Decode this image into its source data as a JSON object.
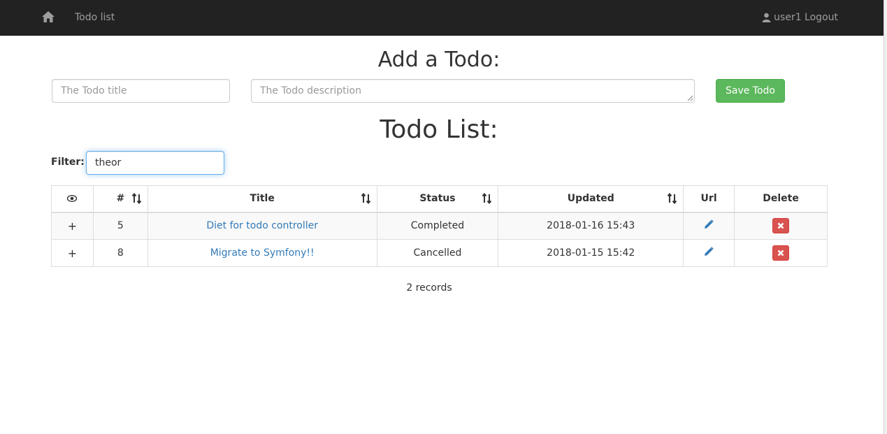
{
  "navbar": {
    "home_icon": "home-icon",
    "brand": "Todo list",
    "user_icon": "user-icon",
    "user_label": "user1 Logout"
  },
  "add_form": {
    "heading": "Add a Todo:",
    "title_placeholder": "The Todo title",
    "description_placeholder": "The Todo description",
    "save_label": "Save Todo"
  },
  "list": {
    "heading": "Todo List:",
    "filter_label": "Filter:",
    "filter_value": "theor",
    "columns": {
      "visibility_icon": "eye-icon",
      "id": "#",
      "title": "Title",
      "status": "Status",
      "updated": "Updated",
      "url": "Url",
      "delete": "Delete"
    },
    "rows": [
      {
        "expand": "+",
        "id": "5",
        "title": "Diet for todo controller",
        "status": "Completed",
        "updated": "2018-01-16 15:43"
      },
      {
        "expand": "+",
        "id": "8",
        "title": "Migrate to Symfony!!",
        "status": "Cancelled",
        "updated": "2018-01-15 15:42"
      }
    ],
    "records": "2 records"
  },
  "colors": {
    "navbar_bg": "#222222",
    "navbar_text": "#9d9d9d",
    "save_button": "#5cb85c",
    "delete_button": "#d9534f",
    "link": "#337ab7",
    "focus_border": "#66afe9"
  }
}
